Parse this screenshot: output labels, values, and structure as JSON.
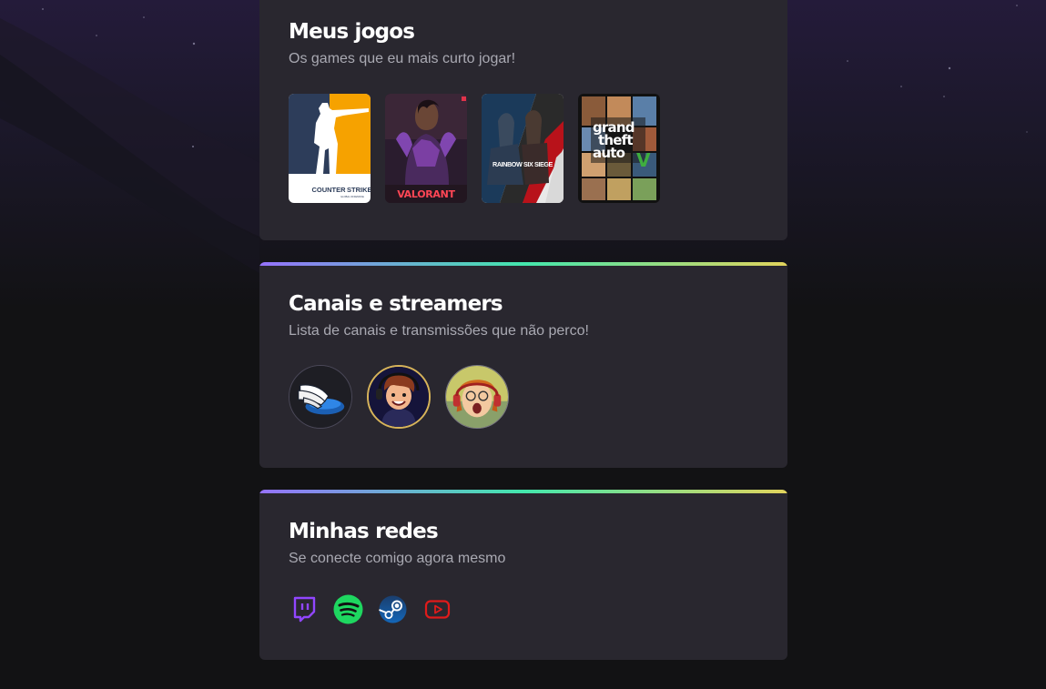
{
  "games_section": {
    "title": "Meus jogos",
    "subtitle": "Os games que eu mais curto jogar!",
    "games": [
      {
        "name": "Counter-Strike",
        "logo_line1": "COUNTER",
        "logo_line2": "STRIKE",
        "logo_sub": "GLOBAL OFFENSIVE",
        "bg": "#f6a200"
      },
      {
        "name": "Valorant",
        "logo": "VALORANT",
        "bg": "#2a1c2e"
      },
      {
        "name": "Rainbow Six Siege",
        "logo": "RAINBOW SIX SIEGE",
        "bg": "#e9e9e9"
      },
      {
        "name": "Grand Theft Auto V",
        "logo_line1": "grand",
        "logo_line2": "theft",
        "logo_line3": "auto",
        "logo_num": "V",
        "bg": "#111111"
      }
    ]
  },
  "streamers_section": {
    "title": "Canais e streamers",
    "subtitle": "Lista de canais e transmissões que não perco!",
    "streamers": [
      {
        "icon": "winged-helmet-avatar"
      },
      {
        "icon": "cartoon-streamer-avatar"
      },
      {
        "icon": "redhead-gamer-avatar"
      }
    ]
  },
  "social_section": {
    "title": "Minhas redes",
    "subtitle": "Se conecte comigo agora mesmo",
    "links": [
      {
        "icon": "twitch-icon",
        "color": "#9146ff"
      },
      {
        "icon": "spotify-icon",
        "color": "#1ed760"
      },
      {
        "icon": "steam-icon",
        "color": "#1b2838"
      },
      {
        "icon": "youtube-icon",
        "color": "#e01b1b"
      }
    ]
  },
  "colors": {
    "background": "#121214",
    "card": "#29272f",
    "gradient": [
      "#9572fc",
      "#43e7ad",
      "#e2d45c"
    ]
  }
}
